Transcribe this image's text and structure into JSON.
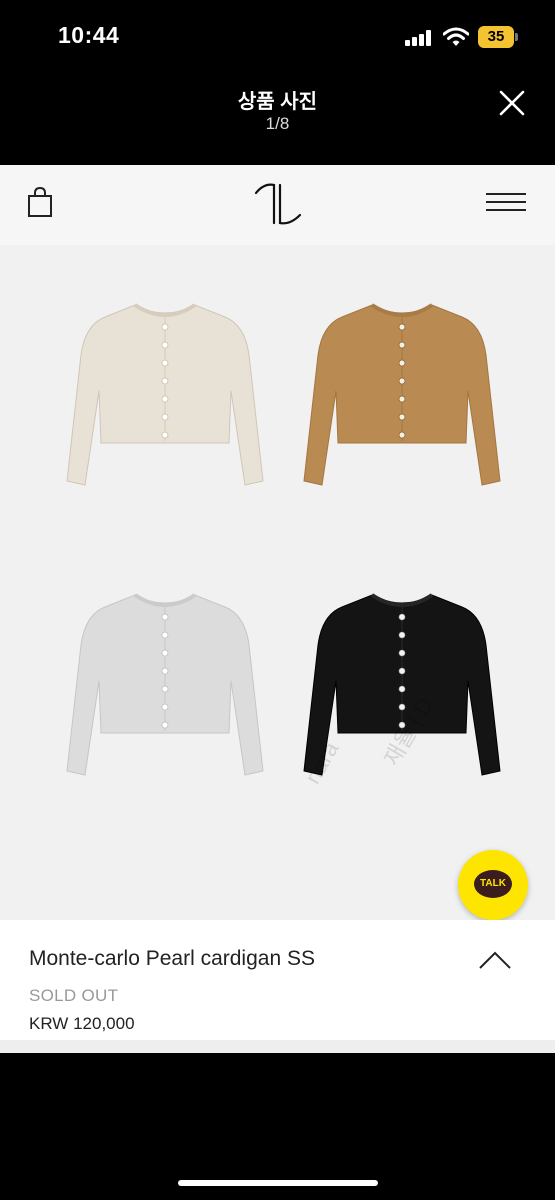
{
  "status_bar": {
    "time": "10:44",
    "battery": "35"
  },
  "viewer": {
    "title": "상품 사진",
    "counter": "1/8"
  },
  "shop": {
    "logo": "TL monogram"
  },
  "product": {
    "name": "Monte-carlo Pearl cardigan SS",
    "status": "SOLD OUT",
    "price": "KRW 120,000",
    "colors": [
      {
        "name": "ivory",
        "hex": "#e8e1d5"
      },
      {
        "name": "camel",
        "hex": "#b98a52"
      },
      {
        "name": "light grey",
        "hex": "#dcdcdc"
      },
      {
        "name": "black",
        "hex": "#141414"
      }
    ]
  },
  "watermark": {
    "line1": "nara",
    "line2": "재율 | D"
  },
  "talk_button": {
    "label": "TALK",
    "color": "#fee500"
  },
  "icons": {
    "bag": "shopping-bag-icon",
    "menu": "hamburger-menu-icon",
    "close": "close-icon",
    "chevron": "chevron-up-icon"
  }
}
